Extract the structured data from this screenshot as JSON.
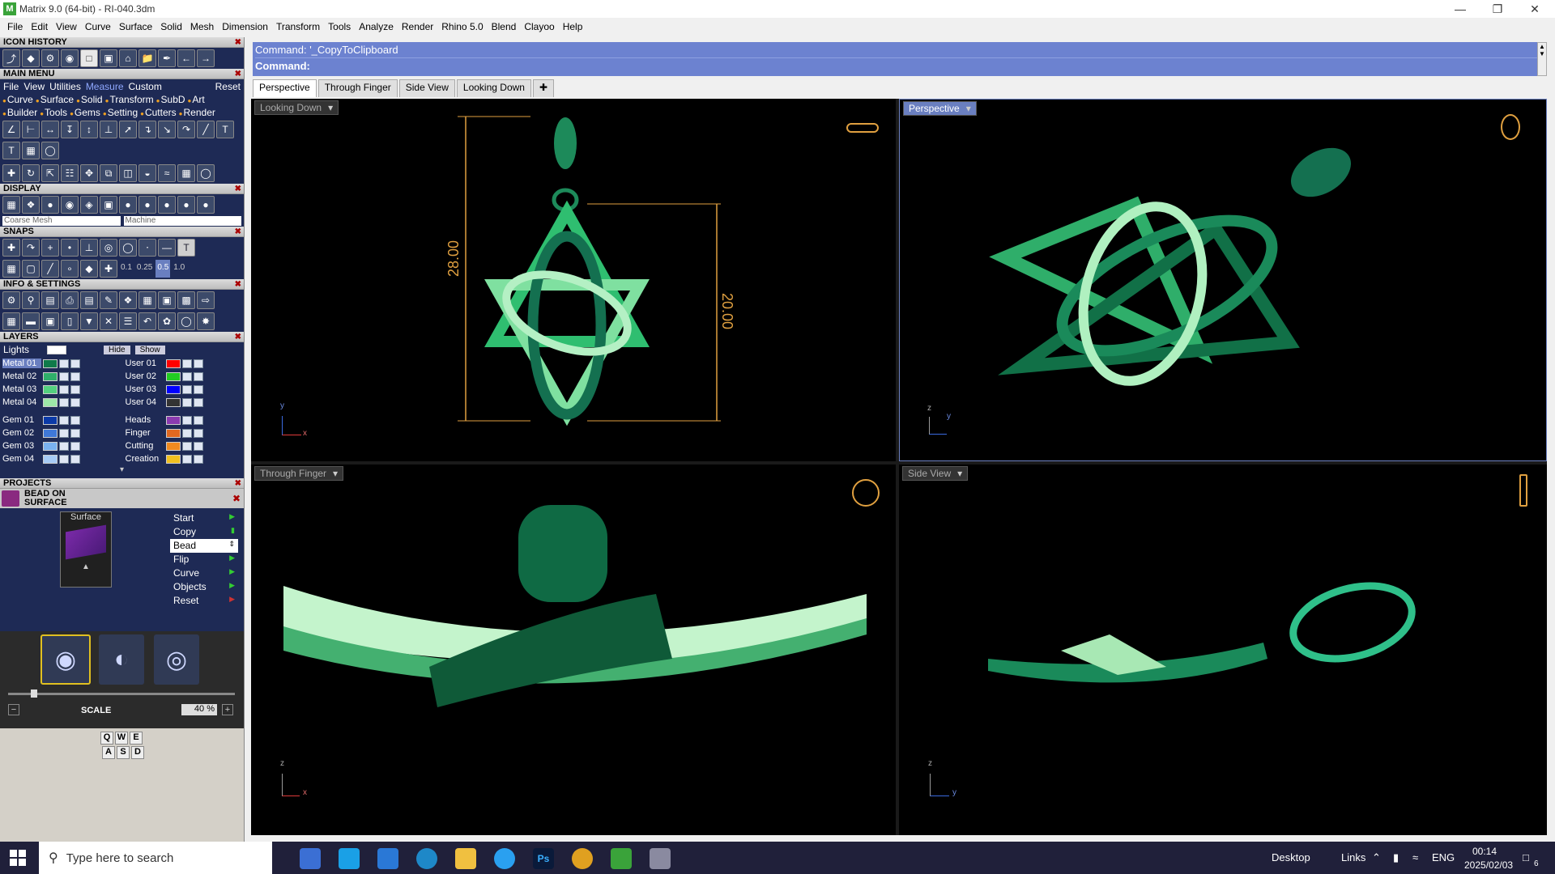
{
  "window": {
    "title": "Matrix 9.0 (64-bit) - RI-040.3dm",
    "app_icon_letter": "M"
  },
  "menubar": [
    "File",
    "Edit",
    "View",
    "Curve",
    "Surface",
    "Solid",
    "Mesh",
    "Dimension",
    "Transform",
    "Tools",
    "Analyze",
    "Render",
    "Rhino 5.0",
    "Blend",
    "Clayoo",
    "Help"
  ],
  "panels": {
    "icon_history": "ICON HISTORY",
    "main_menu": "MAIN MENU",
    "main_menu_tabs": [
      "File",
      "View",
      "Utilities",
      "Measure",
      "Custom",
      "Reset"
    ],
    "main_menu_items_row1": [
      "Curve",
      "Surface",
      "Solid",
      "Transform",
      "SubD",
      "Art"
    ],
    "main_menu_items_row2": [
      "Builder",
      "Tools",
      "Gems",
      "Setting",
      "Cutters",
      "Render"
    ],
    "display": "DISPLAY",
    "display_modes": [
      "Coarse Mesh",
      "Machine"
    ],
    "snaps": "SNAPS",
    "snap_values": [
      "0.1",
      "0.25",
      "0.5",
      "1.0"
    ],
    "info_settings": "INFO & SETTINGS",
    "layers": "LAYERS",
    "layers_lights": "Lights",
    "layers_hide": "Hide",
    "layers_show": "Show",
    "layers_left": [
      {
        "name": "Metal 01",
        "color": "#0f7a4a"
      },
      {
        "name": "Metal 02",
        "color": "#2fae6a"
      },
      {
        "name": "Metal 03",
        "color": "#53d07f"
      },
      {
        "name": "Metal 04",
        "color": "#9de8a8"
      },
      {
        "name": "Gem 01",
        "color": "#0b3aa8"
      },
      {
        "name": "Gem 02",
        "color": "#3f78d8"
      },
      {
        "name": "Gem 03",
        "color": "#7ab2f0"
      },
      {
        "name": "Gem 04",
        "color": "#a7cbf5"
      }
    ],
    "layers_right": [
      {
        "name": "User 01",
        "color": "#ff0000"
      },
      {
        "name": "User 02",
        "color": "#22cc22"
      },
      {
        "name": "User 03",
        "color": "#0000ff"
      },
      {
        "name": "User 04",
        "color": "#333333"
      },
      {
        "name": "Heads",
        "color": "#8b3ab0"
      },
      {
        "name": "Finger",
        "color": "#e06820"
      },
      {
        "name": "Cutting",
        "color": "#f08a20"
      },
      {
        "name": "Creation",
        "color": "#f0c020"
      }
    ],
    "projects": "PROJECTS",
    "project_name": "BEAD ON SURFACE",
    "surface_label": "Surface",
    "project_menu": [
      "Start",
      "Copy",
      "Bead",
      "Flip",
      "Curve",
      "Objects",
      "Reset"
    ],
    "project_menu_selected": "Bead",
    "scale_label": "SCALE",
    "scale_value": "40 %",
    "keys_row1": [
      "Q",
      "W",
      "E"
    ],
    "keys_row2": [
      "A",
      "S",
      "D"
    ]
  },
  "command": {
    "line1": "Command: '_CopyToClipboard",
    "line2": "Command:"
  },
  "view_tabs": [
    "Perspective",
    "Through Finger",
    "Side View",
    "Looking Down"
  ],
  "view_tab_selected": "Perspective",
  "viewports": {
    "top_left": {
      "label": "Looking Down",
      "dim_vertical": "28.00",
      "dim_right": "20.00"
    },
    "top_right": {
      "label": "Perspective"
    },
    "bottom_left": {
      "label": "Through Finger"
    },
    "bottom_right": {
      "label": "Side View"
    }
  },
  "axes": {
    "x": "x",
    "y": "y",
    "z": "z"
  },
  "taskbar": {
    "search_placeholder": "Type here to search",
    "desktop": "Desktop",
    "links": "Links",
    "lang": "ENG",
    "time": "00:14",
    "date": "2025/02/03",
    "notifications": "6"
  }
}
